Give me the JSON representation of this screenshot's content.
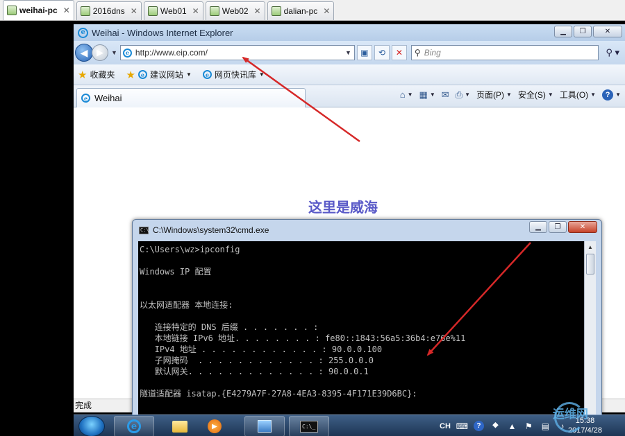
{
  "vm_tabs": [
    {
      "label": "weihai-pc",
      "active": true
    },
    {
      "label": "2016dns",
      "active": false
    },
    {
      "label": "Web01",
      "active": false
    },
    {
      "label": "Web02",
      "active": false
    },
    {
      "label": "dalian-pc",
      "active": false
    }
  ],
  "ie": {
    "window_title": "Weihai - Windows Internet Explorer",
    "address": "http://www.eip.com/",
    "search_placeholder": "Bing",
    "favorites": {
      "favorites_label": "收藏夹",
      "suggested_sites": "建议网站",
      "web_slice_gallery": "网页快讯库"
    },
    "tab_title": "Weihai",
    "command_bar": {
      "page": "页面(P)",
      "safety": "安全(S)",
      "tools": "工具(O)"
    },
    "page_heading": "这里是威海",
    "status": "完成"
  },
  "cmd_window": {
    "title": "C:\\Windows\\system32\\cmd.exe",
    "lines": [
      "C:\\Users\\wz>ipconfig",
      "",
      "Windows IP 配置",
      "",
      "",
      "以太网适配器 本地连接:",
      "",
      "   连接特定的 DNS 后缀 . . . . . . . :",
      "   本地链接 IPv6 地址. . . . . . . . : fe80::1843:56a5:36b4:e76e%11",
      "   IPv4 地址 . . . . . . . . . . . . : 90.0.0.100",
      "   子网掩码  . . . . . . . . . . . . : 255.0.0.0",
      "   默认网关. . . . . . . . . . . . . : 90.0.0.1",
      "",
      "隧道适配器 isatap.{E4279A7F-27A8-4EA3-8395-4F171E39D6BC}:"
    ]
  },
  "taskbar": {
    "language": "CH",
    "time": "15:38",
    "date": "2017/4/28"
  },
  "watermark": "运维网",
  "colors": {
    "annotation_arrow": "#d62828",
    "heading": "#5a5ac8",
    "console_bg": "#000000",
    "console_text": "#c0c0c0"
  }
}
